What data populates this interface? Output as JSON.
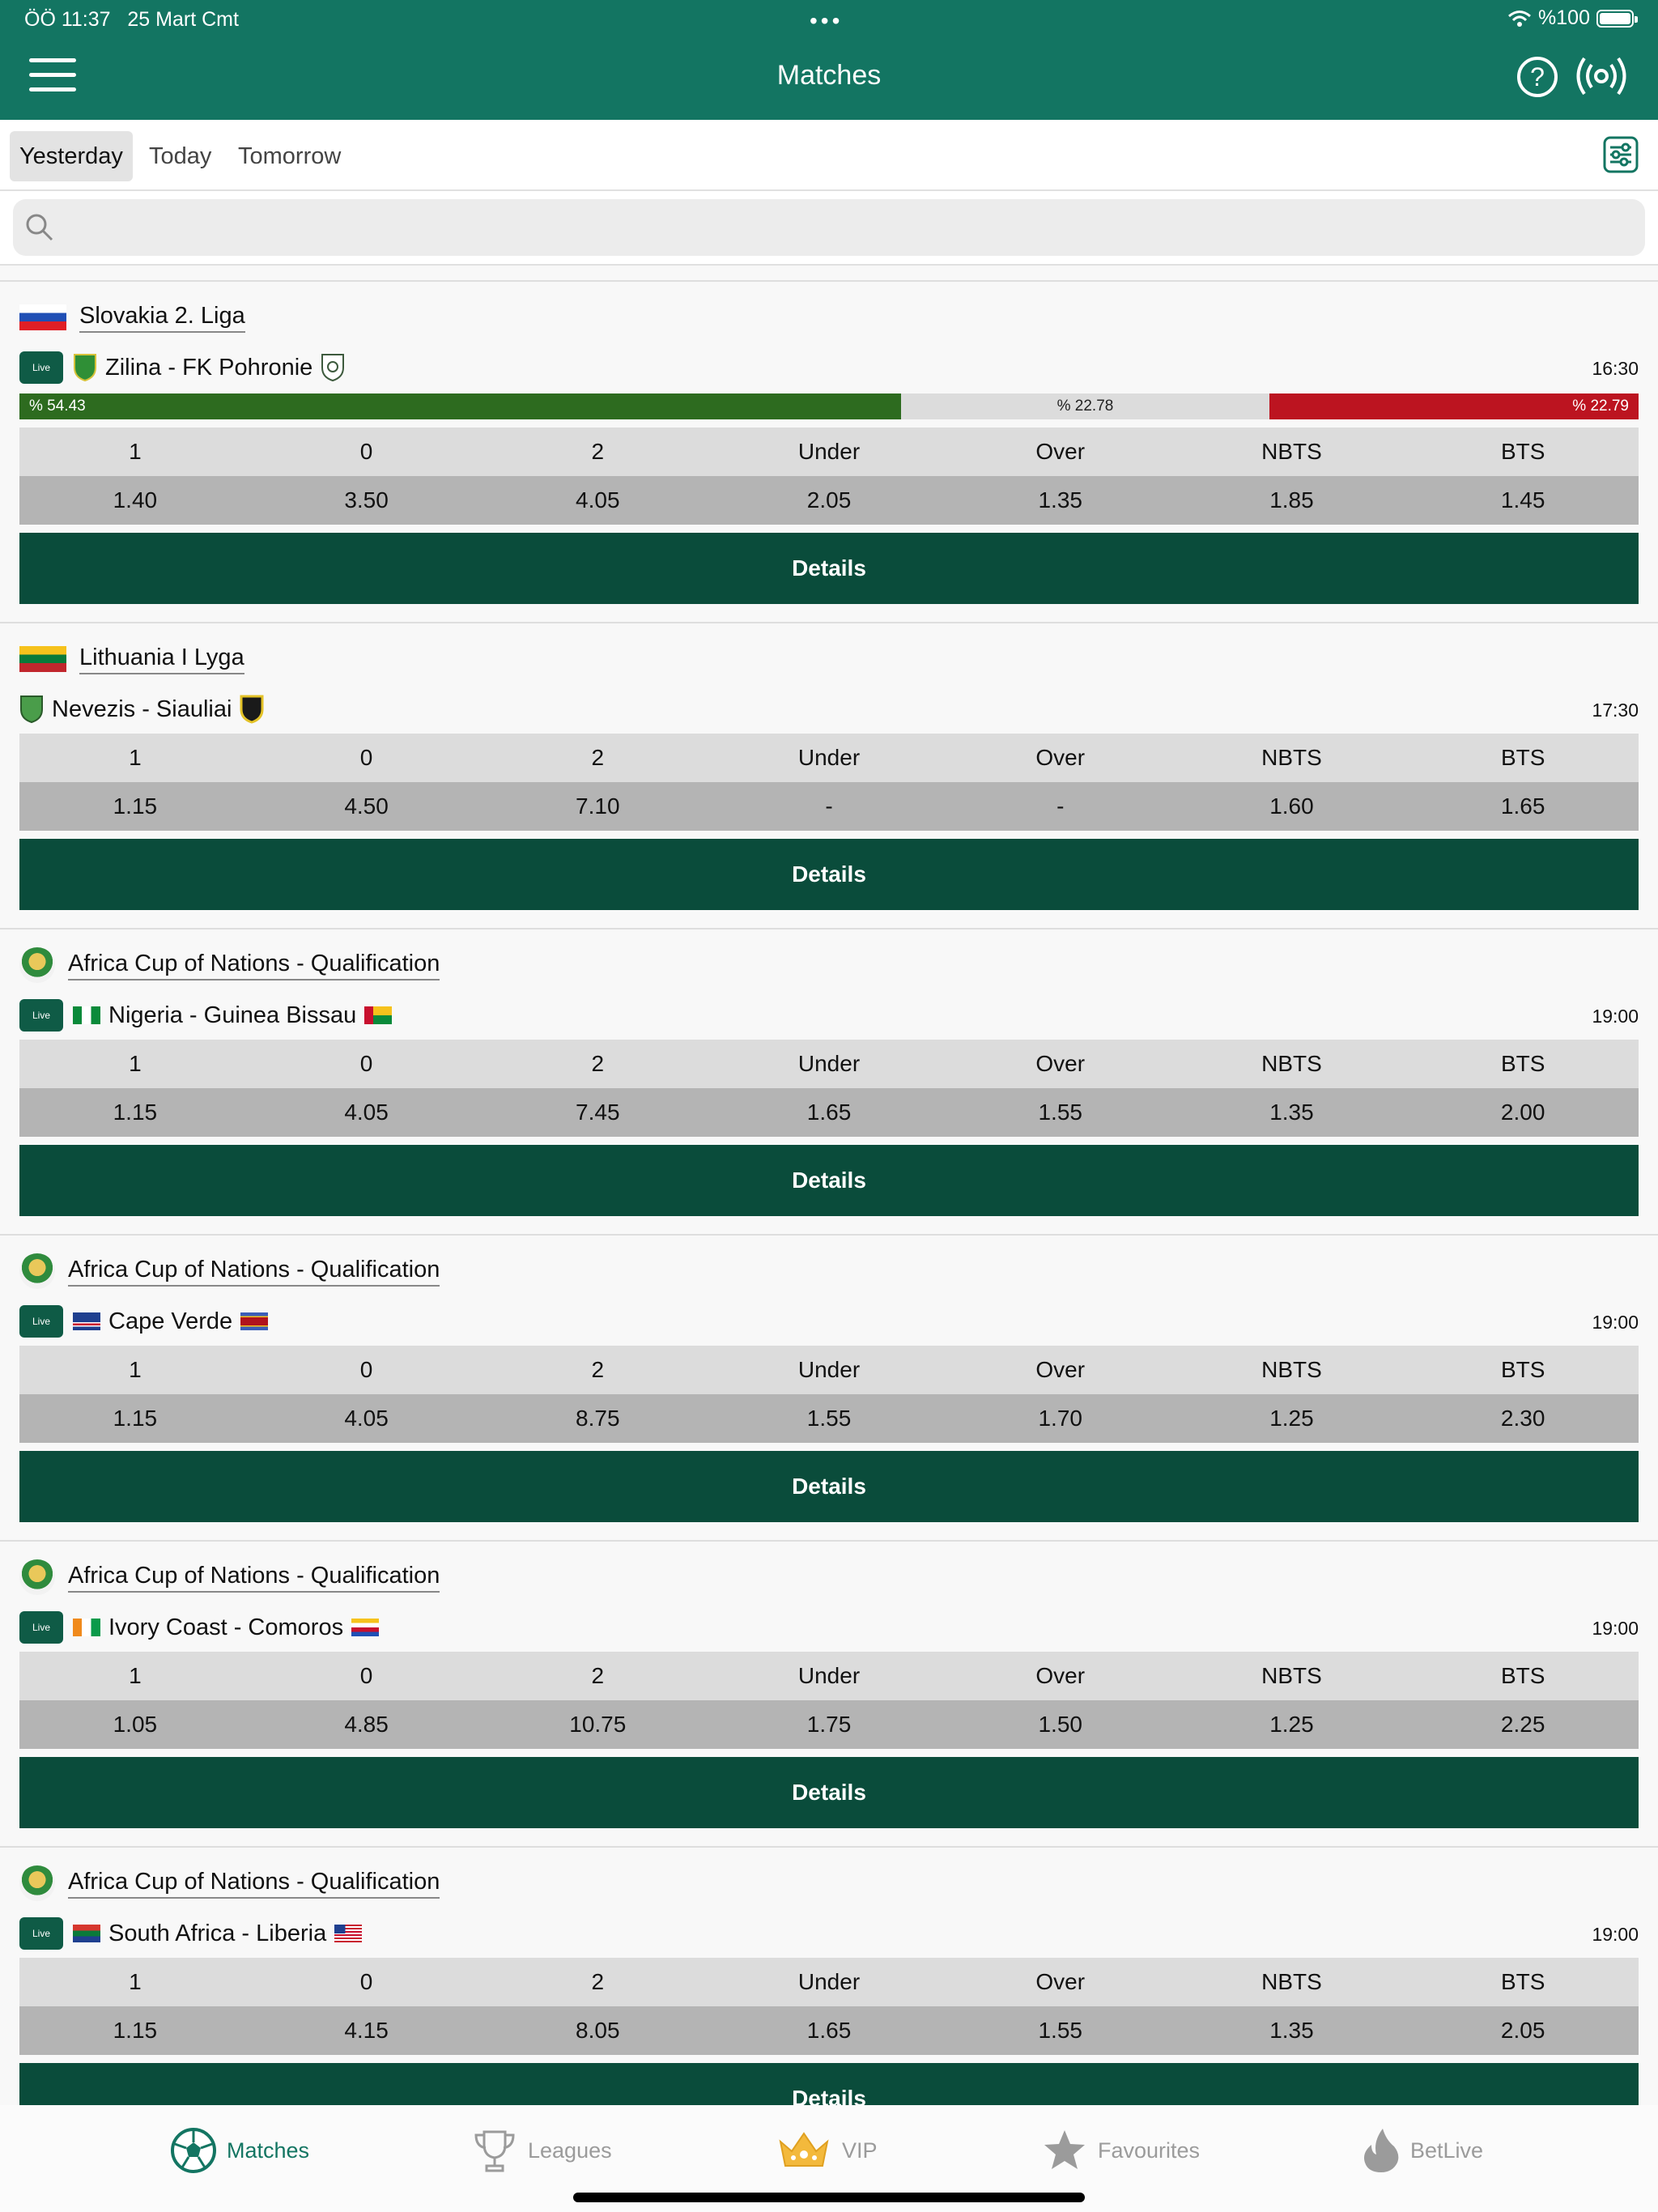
{
  "status": {
    "time": "ÖÖ 11:37",
    "date": "25 Mart Cmt",
    "battery": "%100"
  },
  "header": {
    "title": "Matches"
  },
  "tabs": [
    "Yesterday",
    "Today",
    "Tomorrow"
  ],
  "search": {
    "placeholder": ""
  },
  "odds_headers": [
    "1",
    "0",
    "2",
    "Under",
    "Over",
    "NBTS",
    "BTS"
  ],
  "details_label": "Details",
  "live_label": "Live",
  "matches": [
    {
      "league": "Slovakia 2. Liga",
      "teams": "Zilina  - FK Pohronie",
      "time": "16:30",
      "live": true,
      "probabilities": {
        "home": "% 54.43",
        "draw": "% 22.78",
        "away": "% 22.79"
      },
      "odds": [
        "1.40",
        "3.50",
        "4.05",
        "2.05",
        "1.35",
        "1.85",
        "1.45"
      ]
    },
    {
      "league": "Lithuania I Lyga",
      "teams": "Nevezis - Siauliai",
      "time": "17:30",
      "live": false,
      "odds": [
        "1.15",
        "4.50",
        "7.10",
        "-",
        "-",
        "1.60",
        "1.65"
      ]
    },
    {
      "league": "Africa Cup of Nations - Qualification",
      "teams": "Nigeria - Guinea Bissau",
      "time": "19:00",
      "live": true,
      "odds": [
        "1.15",
        "4.05",
        "7.45",
        "1.65",
        "1.55",
        "1.35",
        "2.00"
      ]
    },
    {
      "league": "Africa Cup of Nations - Qualification",
      "teams": "Cape Verde",
      "time": "19:00",
      "live": true,
      "odds": [
        "1.15",
        "4.05",
        "8.75",
        "1.55",
        "1.70",
        "1.25",
        "2.30"
      ]
    },
    {
      "league": "Africa Cup of Nations - Qualification",
      "teams": "Ivory Coast - Comoros",
      "time": "19:00",
      "live": true,
      "odds": [
        "1.05",
        "4.85",
        "10.75",
        "1.75",
        "1.50",
        "1.25",
        "2.25"
      ]
    },
    {
      "league": "Africa Cup of Nations - Qualification",
      "teams": "South Africa - Liberia",
      "time": "19:00",
      "live": true,
      "odds": [
        "1.15",
        "4.15",
        "8.05",
        "1.65",
        "1.55",
        "1.35",
        "2.05"
      ]
    }
  ],
  "bottom_nav": [
    "Matches",
    "Leagues",
    "VIP",
    "Favourites",
    "BetLive"
  ],
  "colors": {
    "primary": "#137562",
    "details": "#0a4c3b",
    "home_bar": "#2d6b1f",
    "away_bar": "#bc1420"
  }
}
